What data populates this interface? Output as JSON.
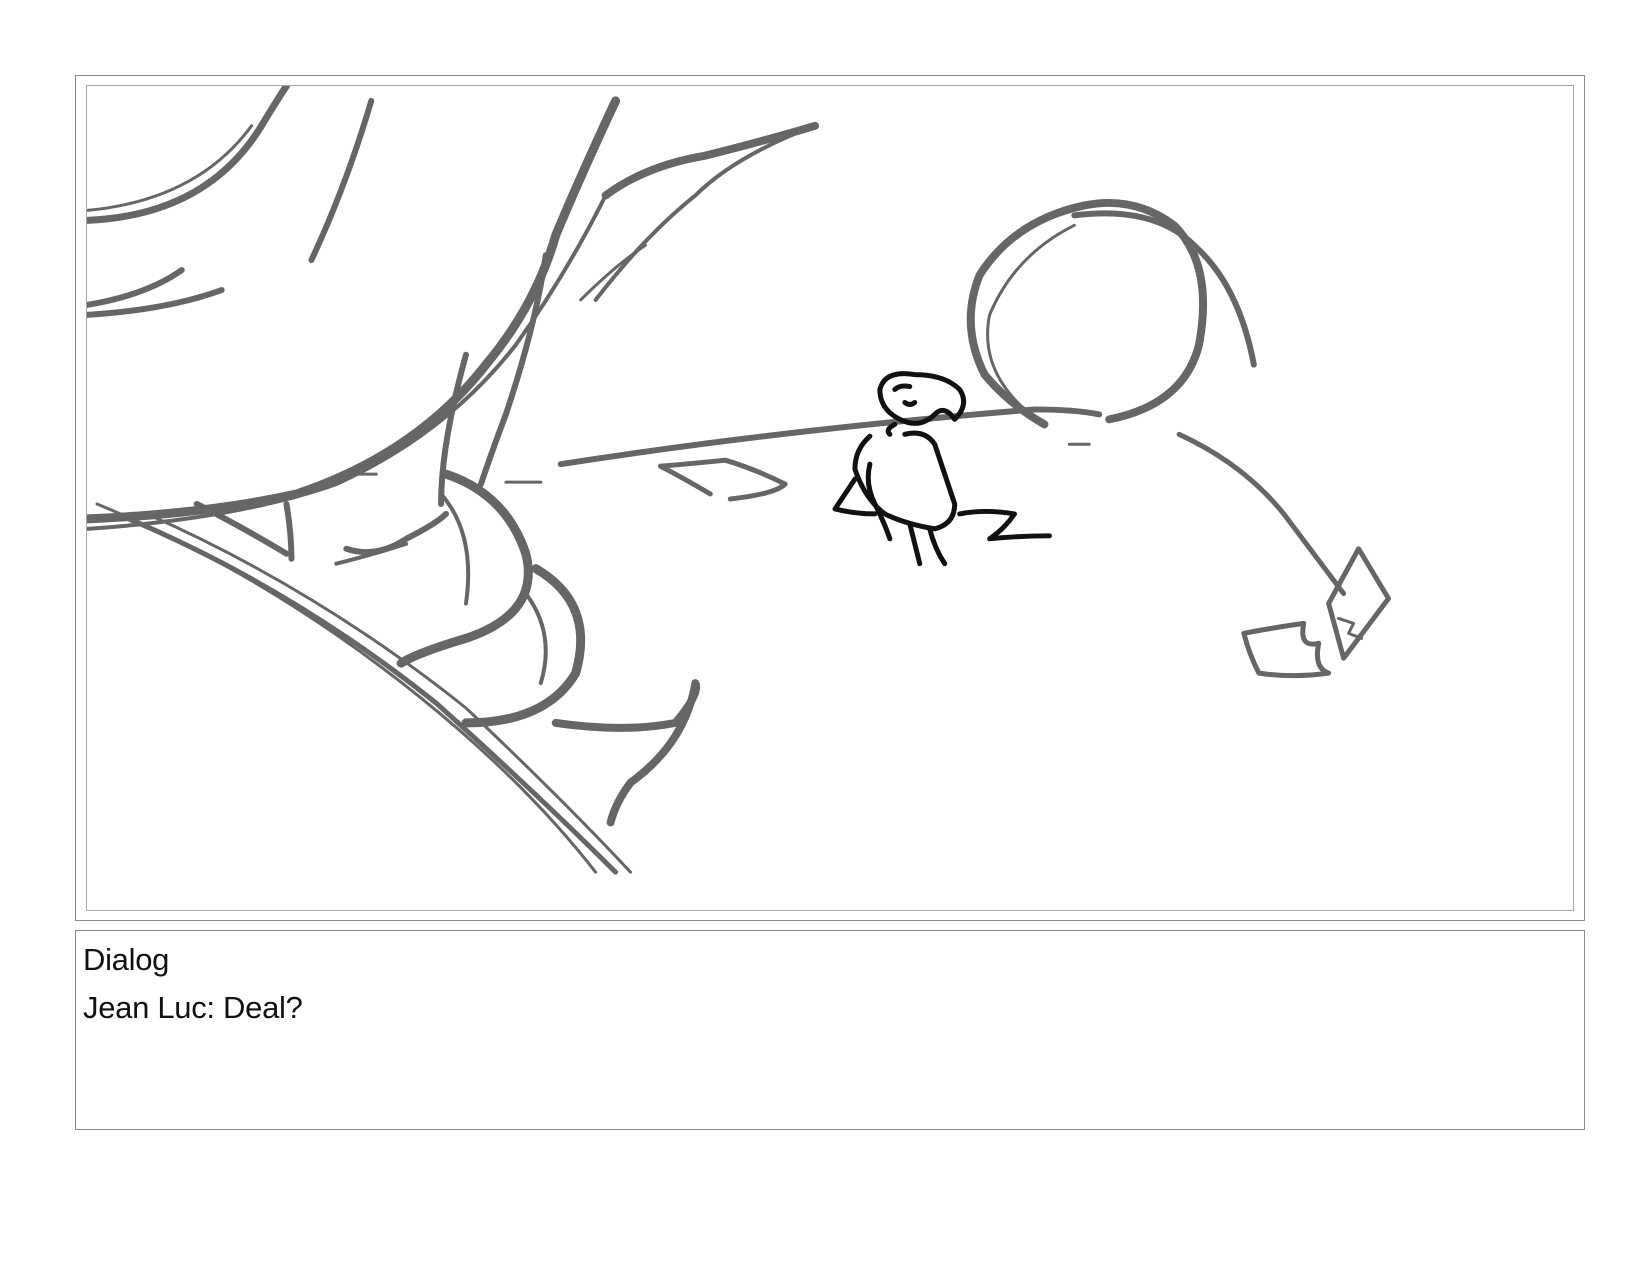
{
  "colors": {
    "sketch_gray": "#666666",
    "character_ink": "#111111",
    "frame": "#8a8a8a"
  },
  "panel": {
    "sketch": "storyboard-sketch"
  },
  "dialog": {
    "heading": "Dialog",
    "line": "Jean Luc: Deal?"
  }
}
